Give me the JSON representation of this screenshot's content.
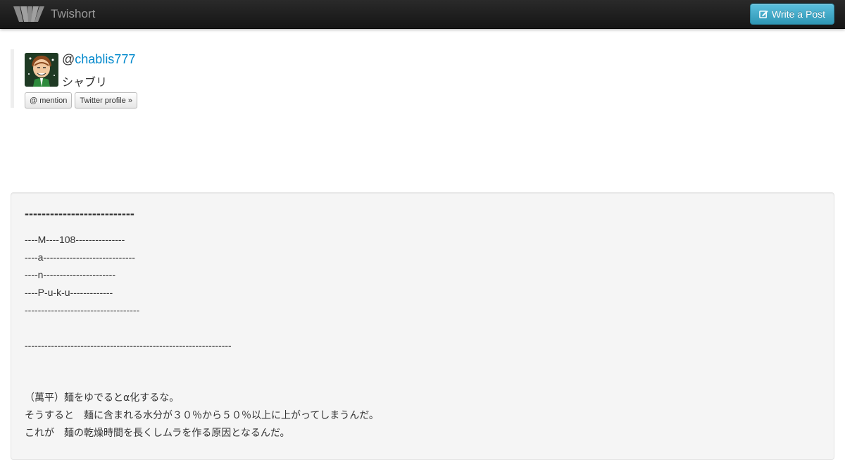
{
  "navbar": {
    "brand_name": "Twishort",
    "write_button_label": "Write a Post",
    "background_color": "#1b1b1b",
    "button_color": "#49afcd"
  },
  "profile": {
    "at_sign": "@",
    "username": "chablis777",
    "display_name": "シャブリ",
    "mention_button_label": "@ mention",
    "twitter_profile_button_label": "Twitter profile »",
    "link_color": "#0088cc"
  },
  "post": {
    "title": "--------------------------",
    "lines": [
      "----M----108---------------",
      "----a----------------------------",
      "----n----------------------",
      "----P-u-k-u-------------",
      "-----------------------------------",
      "",
      "---------------------------------------------------------------",
      "",
      "",
      "（萬平）麺をゆでるとα化するな。",
      "そうすると　麺に含まれる水分が３０％から５０％以上に上がってしまうんだ。",
      "これが　麺の乾燥時間を長くしムラを作る原因となるんだ。"
    ]
  }
}
